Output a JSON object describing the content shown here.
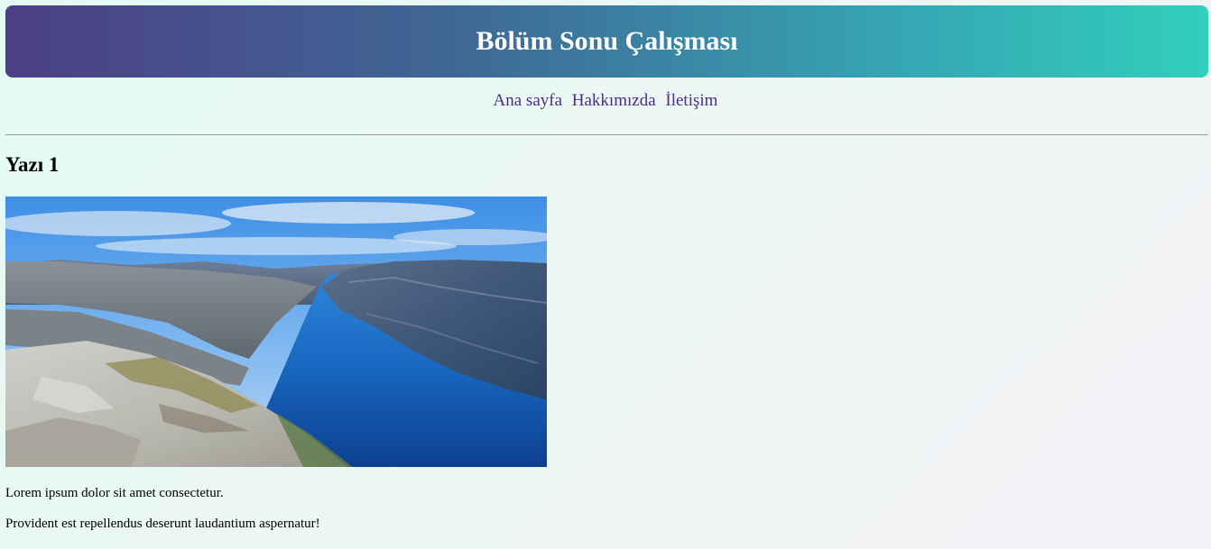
{
  "header": {
    "title": "Bölüm Sonu Çalışması"
  },
  "nav": {
    "items": [
      {
        "label": "Ana sayfa"
      },
      {
        "label": "Hakkımızda"
      },
      {
        "label": "İletişim"
      }
    ]
  },
  "post": {
    "title": "Yazı 1",
    "paragraphs": [
      "Lorem ipsum dolor sit amet consectetur.",
      "Provident est repellendus deserunt laudantium aspernatur!"
    ]
  },
  "colors": {
    "header_gradient_start": "#4c3f83",
    "header_gradient_end": "#31cfbd",
    "nav_link": "#4b2e83",
    "page_background": "#e3fbf4"
  }
}
